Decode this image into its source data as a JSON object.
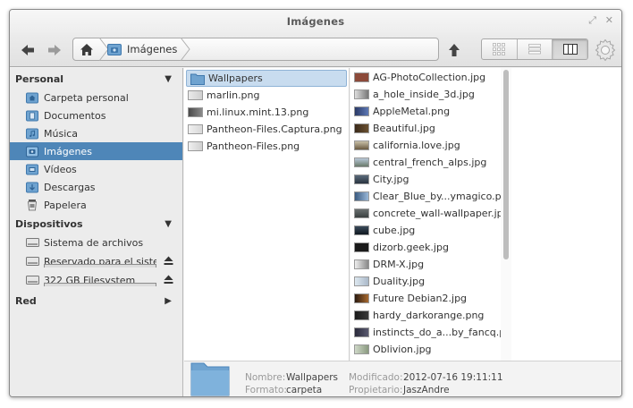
{
  "window": {
    "title": "Imágenes"
  },
  "toolbar": {
    "back_icon": "back-arrow-icon",
    "forward_icon": "forward-arrow-icon",
    "path": {
      "home_icon": "home-icon",
      "crumb": "Imágenes"
    },
    "up_icon": "up-arrow-icon",
    "views": [
      "grid-view-icon",
      "list-view-icon",
      "column-view-icon"
    ],
    "active_view": "column-view-icon",
    "settings_icon": "gear-icon"
  },
  "sidebar": {
    "personal": {
      "title": "Personal",
      "items": [
        {
          "label": "Carpeta personal",
          "icon": "home-folder-icon"
        },
        {
          "label": "Documentos",
          "icon": "documents-folder-icon"
        },
        {
          "label": "Música",
          "icon": "music-folder-icon"
        },
        {
          "label": "Imágenes",
          "icon": "pictures-folder-icon"
        },
        {
          "label": "Vídeos",
          "icon": "videos-folder-icon"
        },
        {
          "label": "Descargas",
          "icon": "downloads-folder-icon"
        },
        {
          "label": "Papelera",
          "icon": "trash-icon"
        }
      ]
    },
    "devices": {
      "title": "Dispositivos",
      "items": [
        {
          "label": "Sistema de archivos"
        },
        {
          "label": "Reservado para el siste..."
        },
        {
          "label": "322 GB Filesystem"
        }
      ]
    },
    "network": {
      "title": "Red"
    }
  },
  "column1": {
    "items": [
      {
        "name": "Wallpapers",
        "type": "folder"
      },
      {
        "name": "marlin.png",
        "type": "image"
      },
      {
        "name": "mi.linux.mint.13.png",
        "type": "image"
      },
      {
        "name": "Pantheon-Files.Captura.png",
        "type": "image"
      },
      {
        "name": "Pantheon-Files.png",
        "type": "image"
      }
    ]
  },
  "column2": {
    "items": [
      "AG-PhotoCollection.jpg",
      "a_hole_inside_3d.jpg",
      "AppleMetal.png",
      "Beautiful.jpg",
      "california.love.jpg",
      "central_french_alps.jpg",
      "City.jpg",
      "Clear_Blue_by...ymagico.png",
      "concrete_wall-wallpaper.jpg",
      "cube.jpg",
      "dizorb.geek.jpg",
      "DRM-X.jpg",
      "Duality.jpg",
      "Future Debian2.jpg",
      "hardy_darkorange.png",
      "instincts_do_a...by_fancq.png",
      "Oblivion.jpg"
    ]
  },
  "details": {
    "name_label": "Nombre:",
    "name_value": "Wallpapers",
    "format_label": "Formato:",
    "format_value": "carpeta",
    "modified_label": "Modificado:",
    "modified_value": "2012-07-16 19:11:11",
    "owner_label": "Propietario:",
    "owner_value": "JaszAndre"
  },
  "colors": {
    "selection": "#4e86b8",
    "folder": "#6fa3d0",
    "column_selection": "#c8dcef"
  }
}
